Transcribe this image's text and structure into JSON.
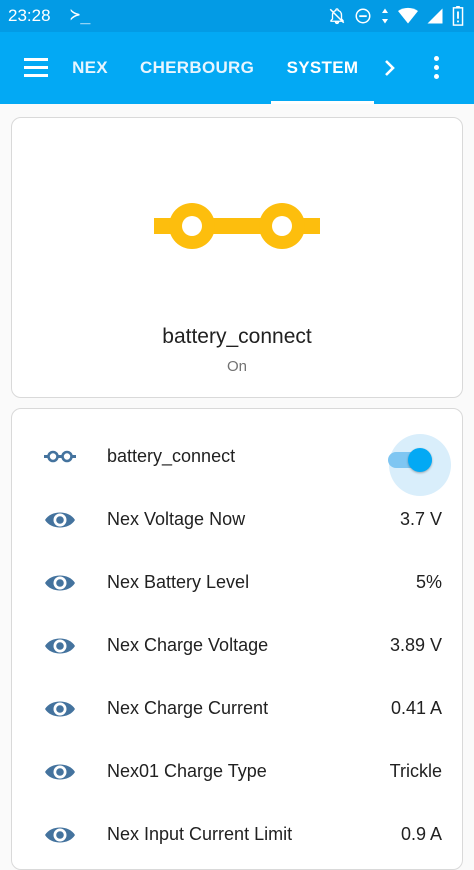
{
  "status_bar": {
    "time": "23:28",
    "terminal_glyph": "≻_"
  },
  "app_bar": {
    "tabs": [
      {
        "label": "NEX",
        "active": false
      },
      {
        "label": "CHERBOURG",
        "active": false
      },
      {
        "label": "SYSTEM",
        "active": true
      }
    ],
    "accent_color": "#03a9f4"
  },
  "entity_card": {
    "icon": "battery-connect-icon",
    "icon_color": "#fdbe0d",
    "name": "battery_connect",
    "state": "On"
  },
  "entities_card": {
    "toggle_row": {
      "label": "battery_connect",
      "icon": "battery-connect-icon",
      "is_on": true
    },
    "sensors": [
      {
        "label": "Nex Voltage Now",
        "value": "3.7 V",
        "icon": "eye-icon"
      },
      {
        "label": "Nex Battery Level",
        "value": "5%",
        "icon": "eye-icon"
      },
      {
        "label": "Nex Charge Voltage",
        "value": "3.89 V",
        "icon": "eye-icon"
      },
      {
        "label": "Nex Charge Current",
        "value": "0.41 A",
        "icon": "eye-icon"
      },
      {
        "label": "Nex01 Charge Type",
        "value": "Trickle",
        "icon": "eye-icon"
      },
      {
        "label": "Nex Input Current Limit",
        "value": "0.9 A",
        "icon": "eye-icon"
      }
    ],
    "icon_color": "#44739e"
  }
}
